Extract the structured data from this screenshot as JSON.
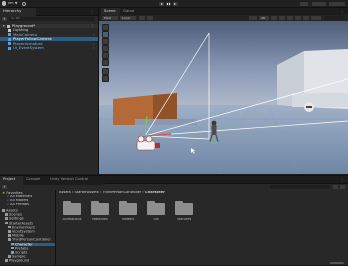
{
  "toolbar": {
    "account": "MR ▼"
  },
  "hierarchy": {
    "tab_label": "Hierarchy",
    "search_placeholder": "Q- All",
    "scene_name": "Playground*",
    "items": [
      {
        "label": "Lighting",
        "depth": 1,
        "state": "normal"
      },
      {
        "label": "MainCamera",
        "depth": 1,
        "state": "prefab"
      },
      {
        "label": "PlayerFollowCamera",
        "depth": 1,
        "state": "selected"
      },
      {
        "label": "PlayerArmature",
        "depth": 1,
        "state": "prefab"
      },
      {
        "label": "UI_EventSystem",
        "depth": 1,
        "state": "prefab"
      }
    ]
  },
  "scene": {
    "tabs": [
      "Scene",
      "Game"
    ],
    "active_tab": "Scene",
    "view_buttons": [
      "Pivot",
      "Local"
    ],
    "mode_button": "2D"
  },
  "project": {
    "tabs": [
      "Project",
      "Console",
      "Unity Version Control"
    ],
    "breadcrumb": [
      "Assets",
      "StarterAssets",
      "ThirdPersonController",
      "Character"
    ],
    "favorites": {
      "label": "Favorites",
      "items": [
        "All Materials",
        "All Models",
        "All Prefabs"
      ]
    },
    "assets_tree": [
      {
        "label": "Assets",
        "depth": 0
      },
      {
        "label": "Scenes",
        "depth": 1
      },
      {
        "label": "Settings",
        "depth": 1
      },
      {
        "label": "StarterAssets",
        "depth": 1
      },
      {
        "label": "Environment",
        "depth": 2
      },
      {
        "label": "InputSystem",
        "depth": 2
      },
      {
        "label": "Mobile",
        "depth": 2
      },
      {
        "label": "ThirdPersonController",
        "depth": 2
      },
      {
        "label": "Character",
        "depth": 3,
        "selected": true
      },
      {
        "label": "Prefabs",
        "depth": 3
      },
      {
        "label": "Scripts",
        "depth": 3
      },
      {
        "label": "Sample",
        "depth": 2
      },
      {
        "label": "Playground",
        "depth": 1
      }
    ],
    "folders": [
      "Animations",
      "Materials",
      "Models",
      "Sfx",
      "Textures"
    ]
  }
}
